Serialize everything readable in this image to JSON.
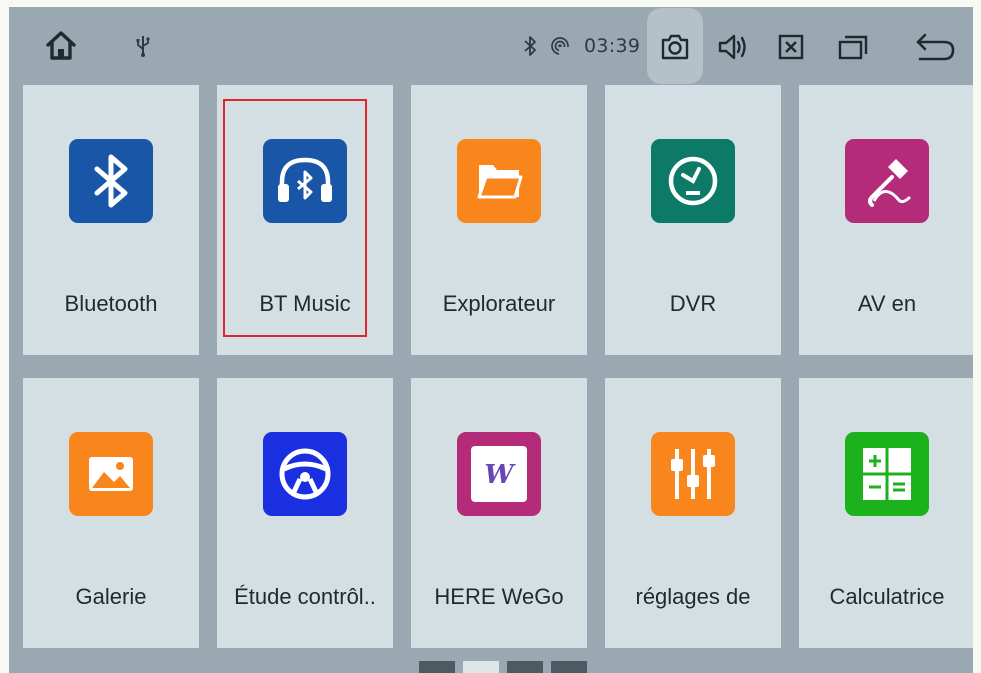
{
  "statusbar": {
    "time": "03:39",
    "icons": [
      "home-icon",
      "usb-icon",
      "bluetooth-icon",
      "wifi-icon",
      "camera-icon",
      "volume-icon",
      "close-window-icon",
      "recent-apps-icon",
      "back-icon"
    ]
  },
  "apps": [
    {
      "label": "Bluetooth",
      "icon": "bluetooth-icon",
      "color": "#1a56a8"
    },
    {
      "label": "BT Music",
      "icon": "headphones-bluetooth-icon",
      "color": "#1a56a8",
      "selected": true
    },
    {
      "label": "Explorateur",
      "icon": "folder-icon",
      "color": "#f8861d"
    },
    {
      "label": "DVR",
      "icon": "speedometer-icon",
      "color": "#0d7a68"
    },
    {
      "label": "AV en",
      "icon": "audio-jack-icon",
      "color": "#b42c79"
    },
    {
      "label": "Galerie",
      "icon": "image-icon",
      "color": "#f8861d"
    },
    {
      "label": "Étude contrôl..",
      "icon": "steering-wheel-icon",
      "color": "#1a2fe0"
    },
    {
      "label": "HERE WeGo",
      "icon": "here-wego-icon",
      "color": "#b42c79"
    },
    {
      "label": "réglages de",
      "icon": "equalizer-icon",
      "color": "#f8861d"
    },
    {
      "label": "Calculatrice",
      "icon": "calculator-icon",
      "color": "#1bb21b"
    }
  ],
  "pager": {
    "pages": 4,
    "current": 2
  },
  "colors": {
    "background": "#99a8b1",
    "tile": "#d4dfe3",
    "highlight": "#e0262a"
  }
}
